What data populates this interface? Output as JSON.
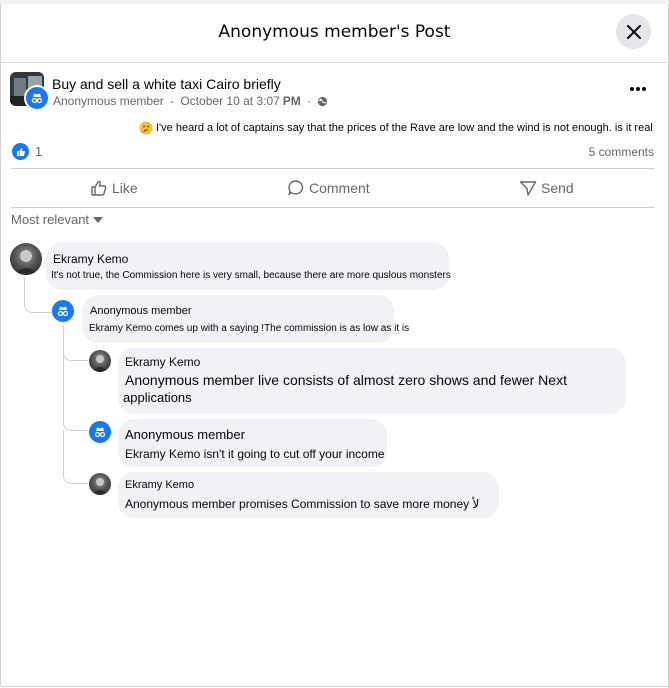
{
  "dialog": {
    "title": "Anonymous member's Post",
    "close_icon": "close-icon"
  },
  "post": {
    "group_name": "Buy and sell a white taxi Cairo briefly",
    "author": "Anonymous member",
    "separator": " - ",
    "time": "October 10 at 3:07",
    "time_suffix": "PM",
    "dot": " · ",
    "privacy_icon": "globe-icon",
    "emoji_icon": "thinking-face-icon",
    "text": "I've heard a lot of captains say that the prices of the Rave are low and the wind is not enough. is it real"
  },
  "stats": {
    "reactions": "1",
    "comments": "5 comments"
  },
  "actions": {
    "like": "Like",
    "comment": "Comment",
    "send": "Send"
  },
  "sort": {
    "label": "Most relevant"
  },
  "comments": [
    {
      "name": "Ekramy Kemo",
      "text": "It's not true, the Commission here is very small, because there are more quslous monsters",
      "avatar": "photo"
    },
    {
      "name": "Anonymous member",
      "text": "Ekramy Kemo comes up with a saying !The commission is as low as it is",
      "avatar": "anonymous"
    },
    {
      "name": "Ekramy Kemo",
      "text": "Anonymous member live consists of almost zero shows and fewer Next applications",
      "line1": "Anonymous member live consists of almost zero shows and fewer Next",
      "line2": "applications",
      "avatar": "photo"
    },
    {
      "name": "Anonymous member",
      "text": "Ekramy Kemo isn't it going to cut off your income",
      "avatar": "anonymous"
    },
    {
      "name": "Ekramy Kemo",
      "text": "Anonymous member promises Commission to save more money لأ",
      "avatar": "photo"
    }
  ],
  "colors": {
    "accent": "#1877f2",
    "bubble": "#f0f2f5",
    "muted": "#65676b",
    "divider": "#ced0d4"
  }
}
